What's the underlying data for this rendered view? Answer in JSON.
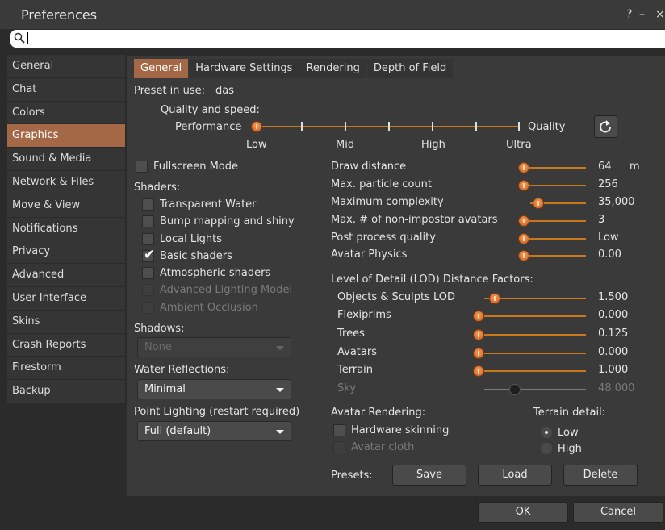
{
  "window": {
    "title": "Preferences",
    "help": "?",
    "minimize": "–",
    "close": "×"
  },
  "search": {
    "value": ""
  },
  "sidebar": {
    "items": [
      "General",
      "Chat",
      "Colors",
      "Graphics",
      "Sound & Media",
      "Network & Files",
      "Move & View",
      "Notifications",
      "Privacy",
      "Advanced",
      "User Interface",
      "Skins",
      "Crash Reports",
      "Firestorm",
      "Backup"
    ],
    "selected": "Graphics"
  },
  "tabs": [
    "General",
    "Hardware Settings",
    "Rendering",
    "Depth of Field"
  ],
  "preset": {
    "label": "Preset in use:",
    "value": "das"
  },
  "quality": {
    "heading": "Quality and speed:",
    "left_label": "Performance",
    "right_label": "Quality",
    "ticks": [
      "Low",
      "Mid",
      "High",
      "Ultra"
    ],
    "level_fraction": 0
  },
  "fullscreen": {
    "label": "Fullscreen Mode",
    "checked": false
  },
  "shaders": {
    "heading": "Shaders:",
    "transparent_water": {
      "label": "Transparent Water",
      "checked": false
    },
    "bump_mapping": {
      "label": "Bump mapping and shiny",
      "checked": false
    },
    "local_lights": {
      "label": "Local Lights",
      "checked": false
    },
    "basic_shaders": {
      "label": "Basic shaders",
      "checked": true
    },
    "atmospheric": {
      "label": "Atmospheric shaders",
      "checked": false
    },
    "advanced_lighting": {
      "label": "Advanced Lighting Model",
      "checked": false,
      "enabled": false
    },
    "ambient_occlusion": {
      "label": "Ambient Occlusion",
      "checked": false,
      "enabled": false
    }
  },
  "shadows": {
    "label": "Shadows:",
    "value": "None"
  },
  "water_reflections": {
    "label": "Water Reflections:",
    "value": "Minimal"
  },
  "point_lighting": {
    "label": "Point Lighting (restart required)",
    "value": "Full (default)"
  },
  "settings": {
    "draw_distance": {
      "label": "Draw distance",
      "value": "64",
      "unit": "m",
      "fraction": 0
    },
    "particle_count": {
      "label": "Max. particle count",
      "value": "256",
      "fraction": 0
    },
    "max_complexity": {
      "label": "Maximum complexity",
      "value": "35,000",
      "fraction": 0.15
    },
    "non_impostor": {
      "label": "Max. # of non-impostor avatars",
      "value": "3",
      "fraction": 0
    },
    "post_process": {
      "label": "Post process quality",
      "value": "Low",
      "fraction": 0
    },
    "avatar_physics": {
      "label": "Avatar Physics",
      "value": "0.00",
      "fraction": 0
    }
  },
  "lod": {
    "heading": "Level of Detail (LOD) Distance Factors:",
    "objects": {
      "label": "Objects & Sculpts LOD",
      "value": "1.500",
      "fraction": 0.1
    },
    "flexiprims": {
      "label": "Flexiprims",
      "value": "0.000",
      "fraction": 0
    },
    "trees": {
      "label": "Trees",
      "value": "0.125",
      "fraction": 0
    },
    "avatars": {
      "label": "Avatars",
      "value": "0.000",
      "fraction": 0
    },
    "terrain": {
      "label": "Terrain",
      "value": "1.000",
      "fraction": 0
    },
    "sky": {
      "label": "Sky",
      "value": "48.000",
      "fraction": 0.3,
      "enabled": false
    }
  },
  "avatar_rendering": {
    "heading": "Avatar Rendering:",
    "hardware_skinning": {
      "label": "Hardware skinning",
      "checked": false
    },
    "avatar_cloth": {
      "label": "Avatar cloth",
      "checked": false,
      "enabled": false
    }
  },
  "terrain_detail": {
    "heading": "Terrain detail:",
    "low": "Low",
    "high": "High",
    "selected": "Low"
  },
  "presets": {
    "label": "Presets:",
    "save": "Save",
    "load": "Load",
    "delete": "Delete"
  },
  "footer": {
    "ok": "OK",
    "cancel": "Cancel"
  },
  "colors": {
    "accent": "#a56846",
    "slider": "#c8781b"
  }
}
